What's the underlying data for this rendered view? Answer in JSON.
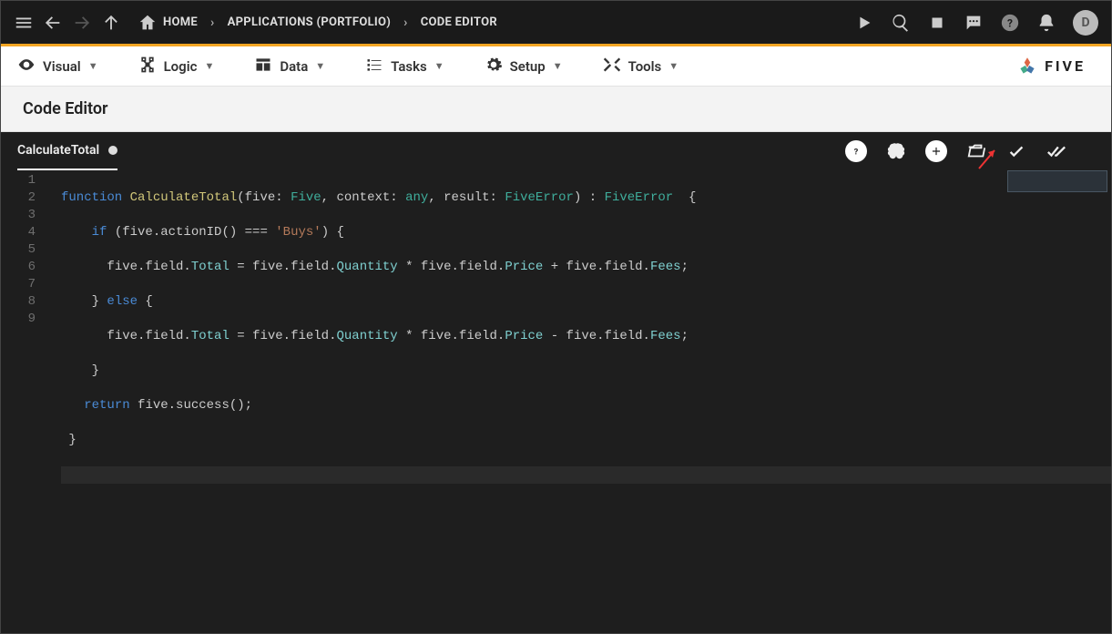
{
  "topbar": {
    "breadcrumbs": [
      "HOME",
      "APPLICATIONS (PORTFOLIO)",
      "CODE EDITOR"
    ],
    "avatar_initial": "D"
  },
  "menu": {
    "items": [
      "Visual",
      "Logic",
      "Data",
      "Tasks",
      "Setup",
      "Tools"
    ],
    "brand": "FIVE"
  },
  "subheader": {
    "title": "Code Editor"
  },
  "tab": {
    "filename": "CalculateTotal"
  },
  "gutter": [
    "1",
    "2",
    "3",
    "4",
    "5",
    "6",
    "7",
    "8",
    "9"
  ],
  "code": {
    "l1": {
      "kw": "function",
      "fn": "CalculateTotal",
      "p1": "(five: ",
      "t1": "Five",
      "p2": ", context: ",
      "t2": "any",
      "p3": ", result: ",
      "t3": "FiveError",
      "p4": ") : ",
      "t4": "FiveError",
      "p5": "  {"
    },
    "l2": {
      "indent": "    ",
      "kw": "if",
      "rest": " (five.actionID() === ",
      "str": "'Buys'",
      "end": ") {"
    },
    "l3": {
      "indent": "      ",
      "a": "five.field.",
      "p1": "Total",
      "b": " = five.field.",
      "p2": "Quantity",
      "c": " * five.field.",
      "p3": "Price",
      "d": " + five.field.",
      "p4": "Fees",
      "e": ";"
    },
    "l4": {
      "indent": "    } ",
      "kw": "else",
      "rest": " {"
    },
    "l5": {
      "indent": "      ",
      "a": "five.field.",
      "p1": "Total",
      "b": " = five.field.",
      "p2": "Quantity",
      "c": " * five.field.",
      "p3": "Price",
      "d": " - five.field.",
      "p4": "Fees",
      "e": ";"
    },
    "l6": {
      "text": "    }"
    },
    "l7": {
      "indent": "   ",
      "kw": "return",
      "rest": " five.success();"
    },
    "l8": {
      "text": " }"
    },
    "l9": {
      "text": ""
    }
  }
}
